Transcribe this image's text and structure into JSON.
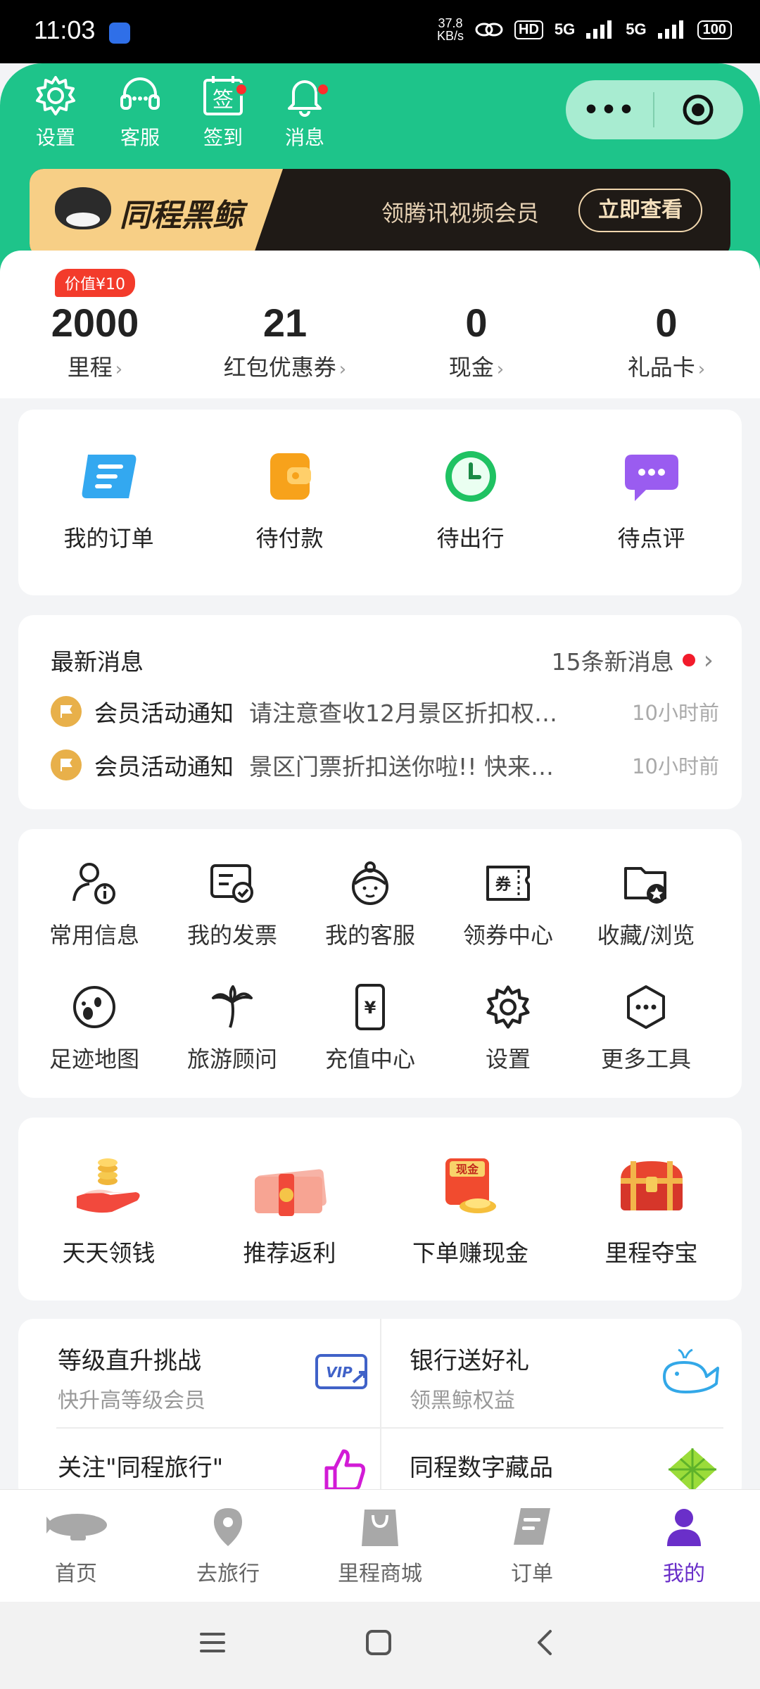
{
  "status_bar": {
    "time": "11:03",
    "net_speed_value": "37.8",
    "net_speed_unit": "KB/s",
    "hd_badge": "HD",
    "signal1": "5G",
    "signal2": "5G",
    "battery": "100"
  },
  "header": {
    "icons": [
      {
        "label": "设置",
        "icon": "gear-icon",
        "badge": false
      },
      {
        "label": "客服",
        "icon": "headset-icon",
        "badge": false
      },
      {
        "label": "签到",
        "icon": "checkin-icon",
        "badge": true,
        "glyph": "签"
      },
      {
        "label": "消息",
        "icon": "bell-icon",
        "badge": true
      }
    ],
    "capsule": {
      "more": "•••",
      "close_icon": "target-icon"
    }
  },
  "banner": {
    "brand": "同程黑鲸",
    "promo_text": "领腾讯视频会员",
    "cta": "立即查看"
  },
  "assets": {
    "value_badge": "价值¥10",
    "items": [
      {
        "value": "2000",
        "label": "里程"
      },
      {
        "value": "21",
        "label": "红包优惠券"
      },
      {
        "value": "0",
        "label": "现金"
      },
      {
        "value": "0",
        "label": "礼品卡"
      }
    ]
  },
  "orders": {
    "items": [
      {
        "label": "我的订单",
        "icon": "order-scroll-icon"
      },
      {
        "label": "待付款",
        "icon": "wallet-icon"
      },
      {
        "label": "待出行",
        "icon": "clock-icon"
      },
      {
        "label": "待点评",
        "icon": "chat-bubble-icon"
      }
    ]
  },
  "messages": {
    "title": "最新消息",
    "count_text": "15条新消息",
    "rows": [
      {
        "category": "会员活动通知",
        "text": "请注意查收12月景区折扣权…",
        "time": "10小时前"
      },
      {
        "category": "会员活动通知",
        "text": "景区门票折扣送你啦!! 快来…",
        "time": "10小时前"
      }
    ]
  },
  "tools": {
    "items": [
      {
        "label": "常用信息",
        "icon": "user-info-icon"
      },
      {
        "label": "我的发票",
        "icon": "invoice-icon"
      },
      {
        "label": "我的客服",
        "icon": "service-agent-icon"
      },
      {
        "label": "领券中心",
        "icon": "coupon-icon"
      },
      {
        "label": "收藏/浏览",
        "icon": "folder-star-icon"
      },
      {
        "label": "足迹地图",
        "icon": "footprint-icon"
      },
      {
        "label": "旅游顾问",
        "icon": "palm-tree-icon"
      },
      {
        "label": "充值中心",
        "icon": "phone-recharge-icon"
      },
      {
        "label": "设置",
        "icon": "gear-icon"
      },
      {
        "label": "更多工具",
        "icon": "more-hexagon-icon"
      }
    ]
  },
  "promos": {
    "items": [
      {
        "label": "天天领钱",
        "icon": "hand-coins-icon"
      },
      {
        "label": "推荐返利",
        "icon": "cash-bundle-icon"
      },
      {
        "label": "下单赚现金",
        "icon": "cash-bag-icon",
        "glyph": "现金"
      },
      {
        "label": "里程夺宝",
        "icon": "treasure-chest-icon"
      }
    ]
  },
  "benefits": {
    "cells": [
      {
        "title": "等级直升挑战",
        "subtitle": "快升高等级会员",
        "icon": "vip-card-icon",
        "glyph": "VIP"
      },
      {
        "title": "银行送好礼",
        "subtitle": "领黑鲸权益",
        "icon": "whale-icon"
      },
      {
        "title": "关注\"同程旅行\"",
        "subtitle": "",
        "icon": "thumb-up-icon"
      },
      {
        "title": "同程数字藏品",
        "subtitle": "",
        "icon": "diamond-icon"
      }
    ]
  },
  "tabbar": {
    "tabs": [
      {
        "label": "首页",
        "icon": "blimp-icon",
        "active": false
      },
      {
        "label": "去旅行",
        "icon": "location-pin-icon",
        "active": false
      },
      {
        "label": "里程商城",
        "icon": "shopping-bag-icon",
        "active": false
      },
      {
        "label": "订单",
        "icon": "document-icon",
        "active": false
      },
      {
        "label": "我的",
        "icon": "person-icon",
        "active": true
      }
    ]
  },
  "colors": {
    "brand_green": "#1ec48a",
    "active_purple": "#6a2fc9",
    "badge_red": "#f33b2b"
  }
}
